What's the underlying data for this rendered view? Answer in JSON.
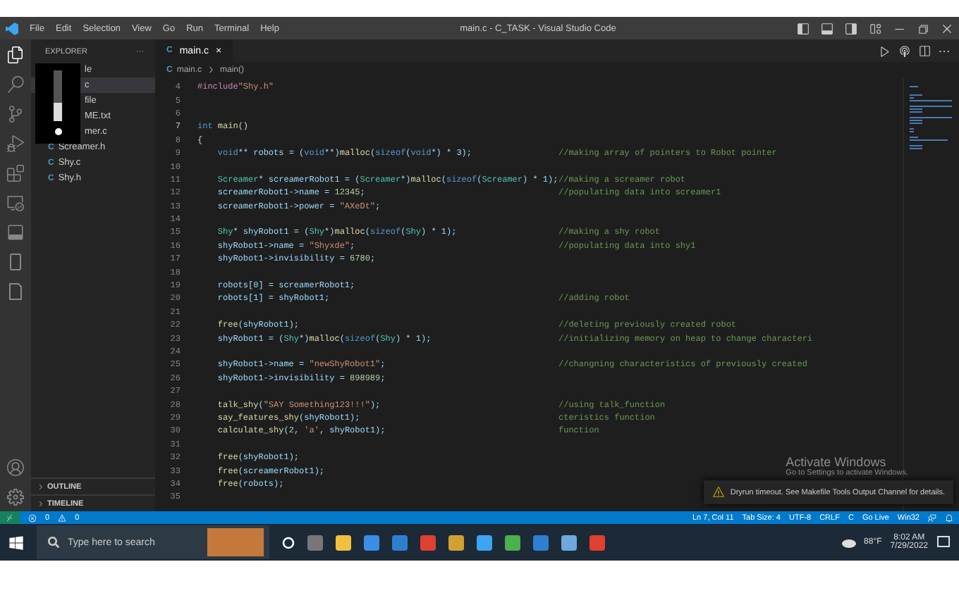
{
  "window": {
    "title": "main.c - C_TASK - Visual Studio Code"
  },
  "menu": [
    "File",
    "Edit",
    "Selection",
    "View",
    "Go",
    "Run",
    "Terminal",
    "Help"
  ],
  "sidebar": {
    "title": "EXPLORER",
    "more": "···",
    "items": [
      {
        "label": "le",
        "selected": false
      },
      {
        "label": "c",
        "selected": true
      },
      {
        "label": "file",
        "selected": false
      },
      {
        "label": "ME.txt",
        "selected": false
      },
      {
        "label": "mer.c",
        "selected": false
      },
      {
        "label": "Screamer.h",
        "lang": "C",
        "selected": false
      },
      {
        "label": "Shy.c",
        "lang": "C",
        "selected": false
      },
      {
        "label": "Shy.h",
        "lang": "C",
        "selected": false
      }
    ],
    "sections": [
      {
        "label": "OUTLINE",
        "expanded": false
      },
      {
        "label": "TIMELINE",
        "expanded": false
      }
    ]
  },
  "volume_popup": {
    "level": 0.35
  },
  "tabs": [
    {
      "icon": "C",
      "label": "main.c",
      "close": "×",
      "selected": true
    }
  ],
  "breadcrumbs": {
    "icon": "C",
    "items": [
      "main.c",
      "main()"
    ]
  },
  "editor": {
    "lines": [
      {
        "n": "4",
        "code": [
          {
            "kind": "pre",
            "t": "#include"
          },
          {
            "kind": "str",
            "t": "\"Shy.h\""
          }
        ]
      },
      {
        "n": "5"
      },
      {
        "n": "6"
      },
      {
        "n": "7",
        "code": [
          {
            "kind": "kw",
            "t": "int"
          },
          {
            "kind": "fn",
            "t": " main"
          },
          {
            "kind": "plain",
            "t": "()"
          }
        ]
      },
      {
        "n": "8",
        "code": [
          {
            "kind": "plain",
            "t": "{"
          }
        ]
      },
      {
        "n": "9",
        "code": [
          {
            "kind": "kw",
            "t": "    void"
          },
          {
            "kind": "var",
            "t": "** robots = ("
          },
          {
            "kind": "kw",
            "t": "void"
          },
          {
            "kind": "var",
            "t": "**)"
          },
          {
            "kind": "fn",
            "t": "malloc"
          },
          {
            "kind": "var",
            "t": "("
          },
          {
            "kind": "kw",
            "t": "sizeof"
          },
          {
            "kind": "var",
            "t": "("
          },
          {
            "kind": "kw",
            "t": "void"
          },
          {
            "kind": "var",
            "t": "*) * 3);"
          }
        ],
        "comment": "//making array of pointers to Robot pointer"
      },
      {
        "n": "10"
      },
      {
        "n": "11",
        "code": [
          {
            "kind": "type",
            "t": "    Screamer"
          },
          {
            "kind": "var",
            "t": "* screamerRobot1 = ("
          },
          {
            "kind": "type",
            "t": "Screamer"
          },
          {
            "kind": "var",
            "t": "*)"
          },
          {
            "kind": "fn",
            "t": "malloc"
          },
          {
            "kind": "var",
            "t": "("
          },
          {
            "kind": "kw",
            "t": "sizeof"
          },
          {
            "kind": "var",
            "t": "("
          },
          {
            "kind": "type",
            "t": "Screamer"
          },
          {
            "kind": "var",
            "t": ") * 1);"
          }
        ],
        "comment": "//making a screamer robot"
      },
      {
        "n": "12",
        "code": [
          {
            "kind": "var",
            "t": "    screamerRobot1->name = "
          },
          {
            "kind": "num",
            "t": "12345"
          },
          {
            "kind": "var",
            "t": ";"
          }
        ],
        "comment": "//populating data into screamer1"
      },
      {
        "n": "13",
        "code": [
          {
            "kind": "var",
            "t": "    screamerRobot1->power = "
          },
          {
            "kind": "str",
            "t": "\"AXeDt\""
          },
          {
            "kind": "var",
            "t": ";"
          }
        ]
      },
      {
        "n": "14"
      },
      {
        "n": "15",
        "code": [
          {
            "kind": "type",
            "t": "    Shy"
          },
          {
            "kind": "var",
            "t": "* shyRobot1 = ("
          },
          {
            "kind": "type",
            "t": "Shy"
          },
          {
            "kind": "var",
            "t": "*)"
          },
          {
            "kind": "fn",
            "t": "malloc"
          },
          {
            "kind": "var",
            "t": "("
          },
          {
            "kind": "kw",
            "t": "sizeof"
          },
          {
            "kind": "var",
            "t": "("
          },
          {
            "kind": "type",
            "t": "Shy"
          },
          {
            "kind": "var",
            "t": ") * 1);"
          }
        ],
        "comment": "//making a shy robot"
      },
      {
        "n": "16",
        "code": [
          {
            "kind": "var",
            "t": "    shyRobot1->name = "
          },
          {
            "kind": "str",
            "t": "\"Shyxde\""
          },
          {
            "kind": "var",
            "t": ";"
          }
        ],
        "comment": "//populating data into shy1"
      },
      {
        "n": "17",
        "code": [
          {
            "kind": "var",
            "t": "    shyRobot1->invisibility = "
          },
          {
            "kind": "num",
            "t": "6780"
          },
          {
            "kind": "var",
            "t": ";"
          }
        ]
      },
      {
        "n": "18"
      },
      {
        "n": "19",
        "code": [
          {
            "kind": "var",
            "t": "    robots[0] = screamerRobot1;"
          }
        ]
      },
      {
        "n": "20",
        "code": [
          {
            "kind": "var",
            "t": "    robots[1] = shyRobot1;"
          }
        ],
        "comment": "//adding robot"
      },
      {
        "n": "21"
      },
      {
        "n": "22",
        "code": [
          {
            "kind": "fn",
            "t": "    free"
          },
          {
            "kind": "var",
            "t": "(shyRobot1);"
          }
        ],
        "comment": "//deleting previously created robot"
      },
      {
        "n": "23",
        "code": [
          {
            "kind": "var",
            "t": "    shyRobot1 = ("
          },
          {
            "kind": "type",
            "t": "Shy"
          },
          {
            "kind": "var",
            "t": "*)"
          },
          {
            "kind": "fn",
            "t": "malloc"
          },
          {
            "kind": "var",
            "t": "("
          },
          {
            "kind": "kw",
            "t": "sizeof"
          },
          {
            "kind": "var",
            "t": "("
          },
          {
            "kind": "type",
            "t": "Shy"
          },
          {
            "kind": "var",
            "t": ") * 1);"
          }
        ],
        "comment": "//initializing memory on heap to change characteri"
      },
      {
        "n": "24"
      },
      {
        "n": "25",
        "code": [
          {
            "kind": "var",
            "t": "    shyRobot1->name = "
          },
          {
            "kind": "str",
            "t": "\"newShyRobot1\""
          },
          {
            "kind": "var",
            "t": ";"
          }
        ],
        "comment": "//changning characteristics of previously created"
      },
      {
        "n": "26",
        "code": [
          {
            "kind": "var",
            "t": "    shyRobot1->invisibility = "
          },
          {
            "kind": "num",
            "t": "898989"
          },
          {
            "kind": "var",
            "t": ";"
          }
        ]
      },
      {
        "n": "27"
      },
      {
        "n": "28",
        "code": [
          {
            "kind": "fn",
            "t": "    talk_shy"
          },
          {
            "kind": "var",
            "t": "("
          },
          {
            "kind": "str",
            "t": "\"SAY Something123!!!\""
          },
          {
            "kind": "var",
            "t": ");"
          }
        ],
        "comment": "//using talk_function"
      },
      {
        "n": "29",
        "code": [
          {
            "kind": "fn",
            "t": "    say_features_shy"
          },
          {
            "kind": "var",
            "t": "(shyRobot1);"
          }
        ],
        "comment": "cteristics function"
      },
      {
        "n": "30",
        "code": [
          {
            "kind": "fn",
            "t": "    calculate_shy"
          },
          {
            "kind": "var",
            "t": "("
          },
          {
            "kind": "num",
            "t": "2"
          },
          {
            "kind": "var",
            "t": ", "
          },
          {
            "kind": "str",
            "t": "'a'"
          },
          {
            "kind": "var",
            "t": ", shyRobot1);"
          }
        ],
        "comment": "function"
      },
      {
        "n": "31"
      },
      {
        "n": "32",
        "code": [
          {
            "kind": "fn",
            "t": "    free"
          },
          {
            "kind": "var",
            "t": "(shyRobot1);"
          }
        ]
      },
      {
        "n": "33",
        "code": [
          {
            "kind": "fn",
            "t": "    free"
          },
          {
            "kind": "var",
            "t": "(screamerRobot1);"
          }
        ]
      },
      {
        "n": "34",
        "code": [
          {
            "kind": "fn",
            "t": "    free"
          },
          {
            "kind": "var",
            "t": "(robots);"
          }
        ]
      },
      {
        "n": "35"
      }
    ]
  },
  "notification": {
    "text": "Dryrun timeout. See Makefile Tools Output Channel for details."
  },
  "activation": {
    "title": "Activate Windows",
    "text": "Go to Settings to activate Windows."
  },
  "status_bar": {
    "errors": "0",
    "warnings": "0",
    "right": [
      "Ln 7, Col 11",
      "Tab Size: 4",
      "UTF-8",
      "CRLF",
      "C",
      "Go Live",
      "Win32"
    ]
  },
  "taskbar": {
    "search_placeholder": "Type here to search",
    "temperature": "88°F",
    "time": "8:02 AM",
    "date": "7/29/2022"
  }
}
